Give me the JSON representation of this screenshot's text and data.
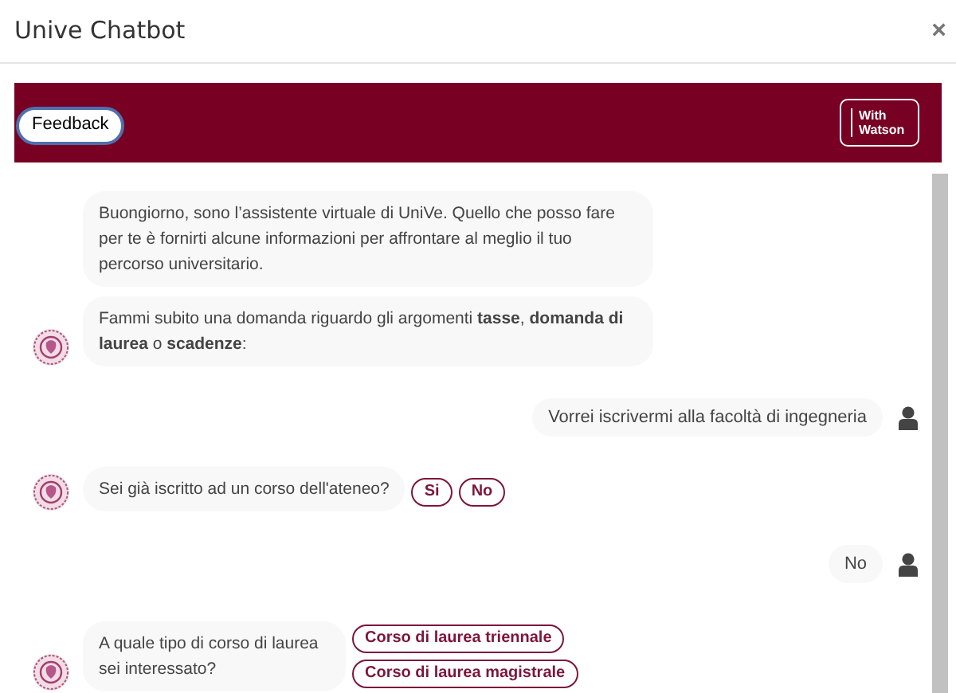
{
  "window": {
    "title": "Unive Chatbot",
    "close": "×"
  },
  "banner": {
    "feedback_button": "Feedback",
    "badge": [
      "With",
      "Watson"
    ]
  },
  "messages": [
    {
      "kind": "bot",
      "avatar": false,
      "text": "Buongiorno, sono l’assistente virtuale di UniVe. Quello che posso fare per te è fornirti alcune informazioni per affrontare al meglio il tuo percorso universitario."
    },
    {
      "kind": "bot",
      "avatar": true,
      "text": "Fammi subito una domanda riguardo gli argomenti **tasse**, **domanda di laurea** o **scadenze**:"
    },
    {
      "kind": "user",
      "text": "Vorrei iscrivermi alla facoltà di ingegneria"
    },
    {
      "kind": "quickreply",
      "avatar": true,
      "text": "Sei già iscritto ad un corso dell'ateneo?",
      "options": [
        "Si",
        "No"
      ]
    },
    {
      "kind": "user",
      "text": "No"
    },
    {
      "kind": "menu",
      "avatar": true,
      "text": "A quale tipo di corso di laurea sei interessato?",
      "options": [
        "Corso di laurea triennale",
        "Corso di laurea magistrale"
      ]
    }
  ]
}
